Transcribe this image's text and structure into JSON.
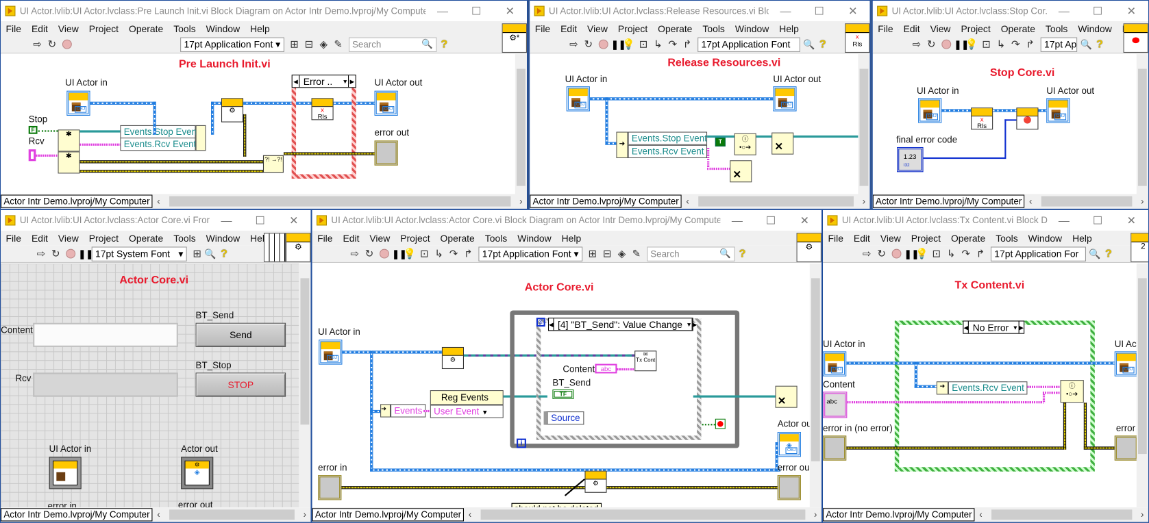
{
  "menu": [
    "File",
    "Edit",
    "View",
    "Project",
    "Operate",
    "Tools",
    "Window",
    "Help"
  ],
  "status_project": "Actor Intr Demo.lvproj/My Computer",
  "windows": {
    "pre_launch": {
      "title": "UI Actor.lvlib:UI Actor.lvclass:Pre Launch Init.vi Block Diagram on Actor Intr Demo.lvproj/My Computer",
      "font": "17pt Application Font",
      "search_placeholder": "Search",
      "heading": "Pre Launch Init.vi",
      "labels": {
        "actor_in": "UI Actor in",
        "actor_out": "UI Actor out",
        "stop": "Stop",
        "rcv": "Rcv",
        "error_out": "error out"
      },
      "stop_const": "F",
      "bundle": [
        "Events.Stop Event",
        "Events.Rcv Event"
      ],
      "case_selector": "Error ..",
      "release_node": "Rls",
      "connector_icon": "gear-new"
    },
    "release": {
      "title": "UI Actor.lvlib:UI Actor.lvclass:Release Resources.vi Blo...",
      "font": "17pt Application Font",
      "heading": "Release Resources.vi",
      "labels": {
        "actor_in": "UI Actor in",
        "actor_out": "UI Actor out"
      },
      "unbundle": [
        "Events.Stop Event",
        "Events.Rcv Event"
      ],
      "bool_const": "T",
      "connector_icon": "Rls"
    },
    "stop_core": {
      "title": "UI Actor.lvlib:UI Actor.lvclass:Stop Cor...",
      "font": "17pt Ap",
      "heading": "Stop Core.vi",
      "labels": {
        "actor_in": "UI Actor in",
        "actor_out": "UI Actor out",
        "final_error": "final error code"
      },
      "numeric": "1.23",
      "numeric_type": "I32",
      "release_node": "Rls"
    },
    "actor_core_fp": {
      "title": "UI Actor.lvlib:UI Actor.lvclass:Actor Core.vi Front...",
      "font": "17pt System Font",
      "heading": "Actor Core.vi",
      "labels": {
        "content": "Content",
        "rcv": "Rcv",
        "bt_send": "BT_Send",
        "bt_stop": "BT_Stop",
        "actor_in": "UI Actor in",
        "actor_out": "Actor out",
        "error_in": "error in",
        "error_out": "error out"
      },
      "content_value": "",
      "rcv_value": "",
      "send_button": "Send",
      "stop_button": "STOP"
    },
    "actor_core_bd": {
      "title": "UI Actor.lvlib:UI Actor.lvclass:Actor Core.vi Block Diagram on Actor Intr Demo.lvproj/My Computer",
      "font": "17pt Application Font",
      "search_placeholder": "Search",
      "heading": "Actor Core.vi",
      "labels": {
        "actor_in": "UI Actor in",
        "actor_out": "Actor ou",
        "error_in": "error in",
        "error_out": "error ou",
        "content": "Content",
        "bt_send": "BT_Send"
      },
      "event_case": "[4] \"BT_Send\": Value Change",
      "events_bundle": "Events",
      "reg_events": "Reg Events",
      "user_event": "User Event",
      "source": "Source",
      "tf_const": "TF",
      "str_const": "abc",
      "tx_node": "Tx Cont",
      "loop_index": "i",
      "comment": "should not be deleted"
    },
    "tx_content": {
      "title": "UI Actor.lvlib:UI Actor.lvclass:Tx Content.vi Block Di...",
      "font": "17pt Application For",
      "heading": "Tx Content.vi",
      "labels": {
        "actor_in": "UI Actor in",
        "actor_out": "UI Acto",
        "content": "Content",
        "error_in": "error in (no error)",
        "error_out": "error"
      },
      "case_selector": "No Error",
      "unbundle": "Events.Rcv Event",
      "str_const": "abc",
      "connector_value": "2"
    }
  },
  "colors": {
    "heading": "#e8192c",
    "class_wire": "#1e7be0",
    "error_wire": "#e6d600",
    "string_wire": "#e040e0",
    "ref_wire": "#2a9a9a"
  }
}
